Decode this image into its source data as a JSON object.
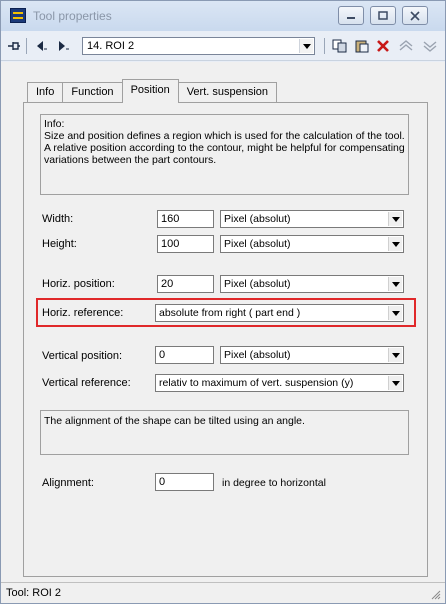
{
  "window": {
    "title": "Tool properties"
  },
  "toolbar": {
    "roi_selected": "14. ROI 2"
  },
  "tabs": [
    {
      "label": "Info",
      "active": false
    },
    {
      "label": "Function",
      "active": false
    },
    {
      "label": "Position",
      "active": true
    },
    {
      "label": "Vert. suspension",
      "active": false
    }
  ],
  "info": {
    "heading": "Info:",
    "text": "Size and position defines a region which is used for the calculation of the tool. A relative position according to the contour, might be helpful for compensating variations between the part contours."
  },
  "fields": {
    "width": {
      "label": "Width:",
      "value": "160",
      "unit": "Pixel (absolut)"
    },
    "height": {
      "label": "Height:",
      "value": "100",
      "unit": "Pixel (absolut)"
    },
    "horiz_position": {
      "label": "Horiz. position:",
      "value": "20",
      "unit": "Pixel (absolut)"
    },
    "horiz_reference": {
      "label": "Horiz. reference:",
      "value": "absolute from right ( part end )"
    },
    "vertical_position": {
      "label": "Vertical position:",
      "value": "0",
      "unit": "Pixel (absolut)"
    },
    "vertical_reference": {
      "label": "Vertical reference:",
      "value": "relativ to maximum of vert. suspension (y)"
    }
  },
  "alignment_info": "The alignment of the shape can be tilted using an angle.",
  "alignment": {
    "label": "Alignment:",
    "value": "0",
    "suffix": "in degree to horizontal"
  },
  "status": {
    "text": "Tool: ROI 2"
  },
  "colors": {
    "highlight": "#e0282a",
    "accent": "#c9d9ee"
  }
}
